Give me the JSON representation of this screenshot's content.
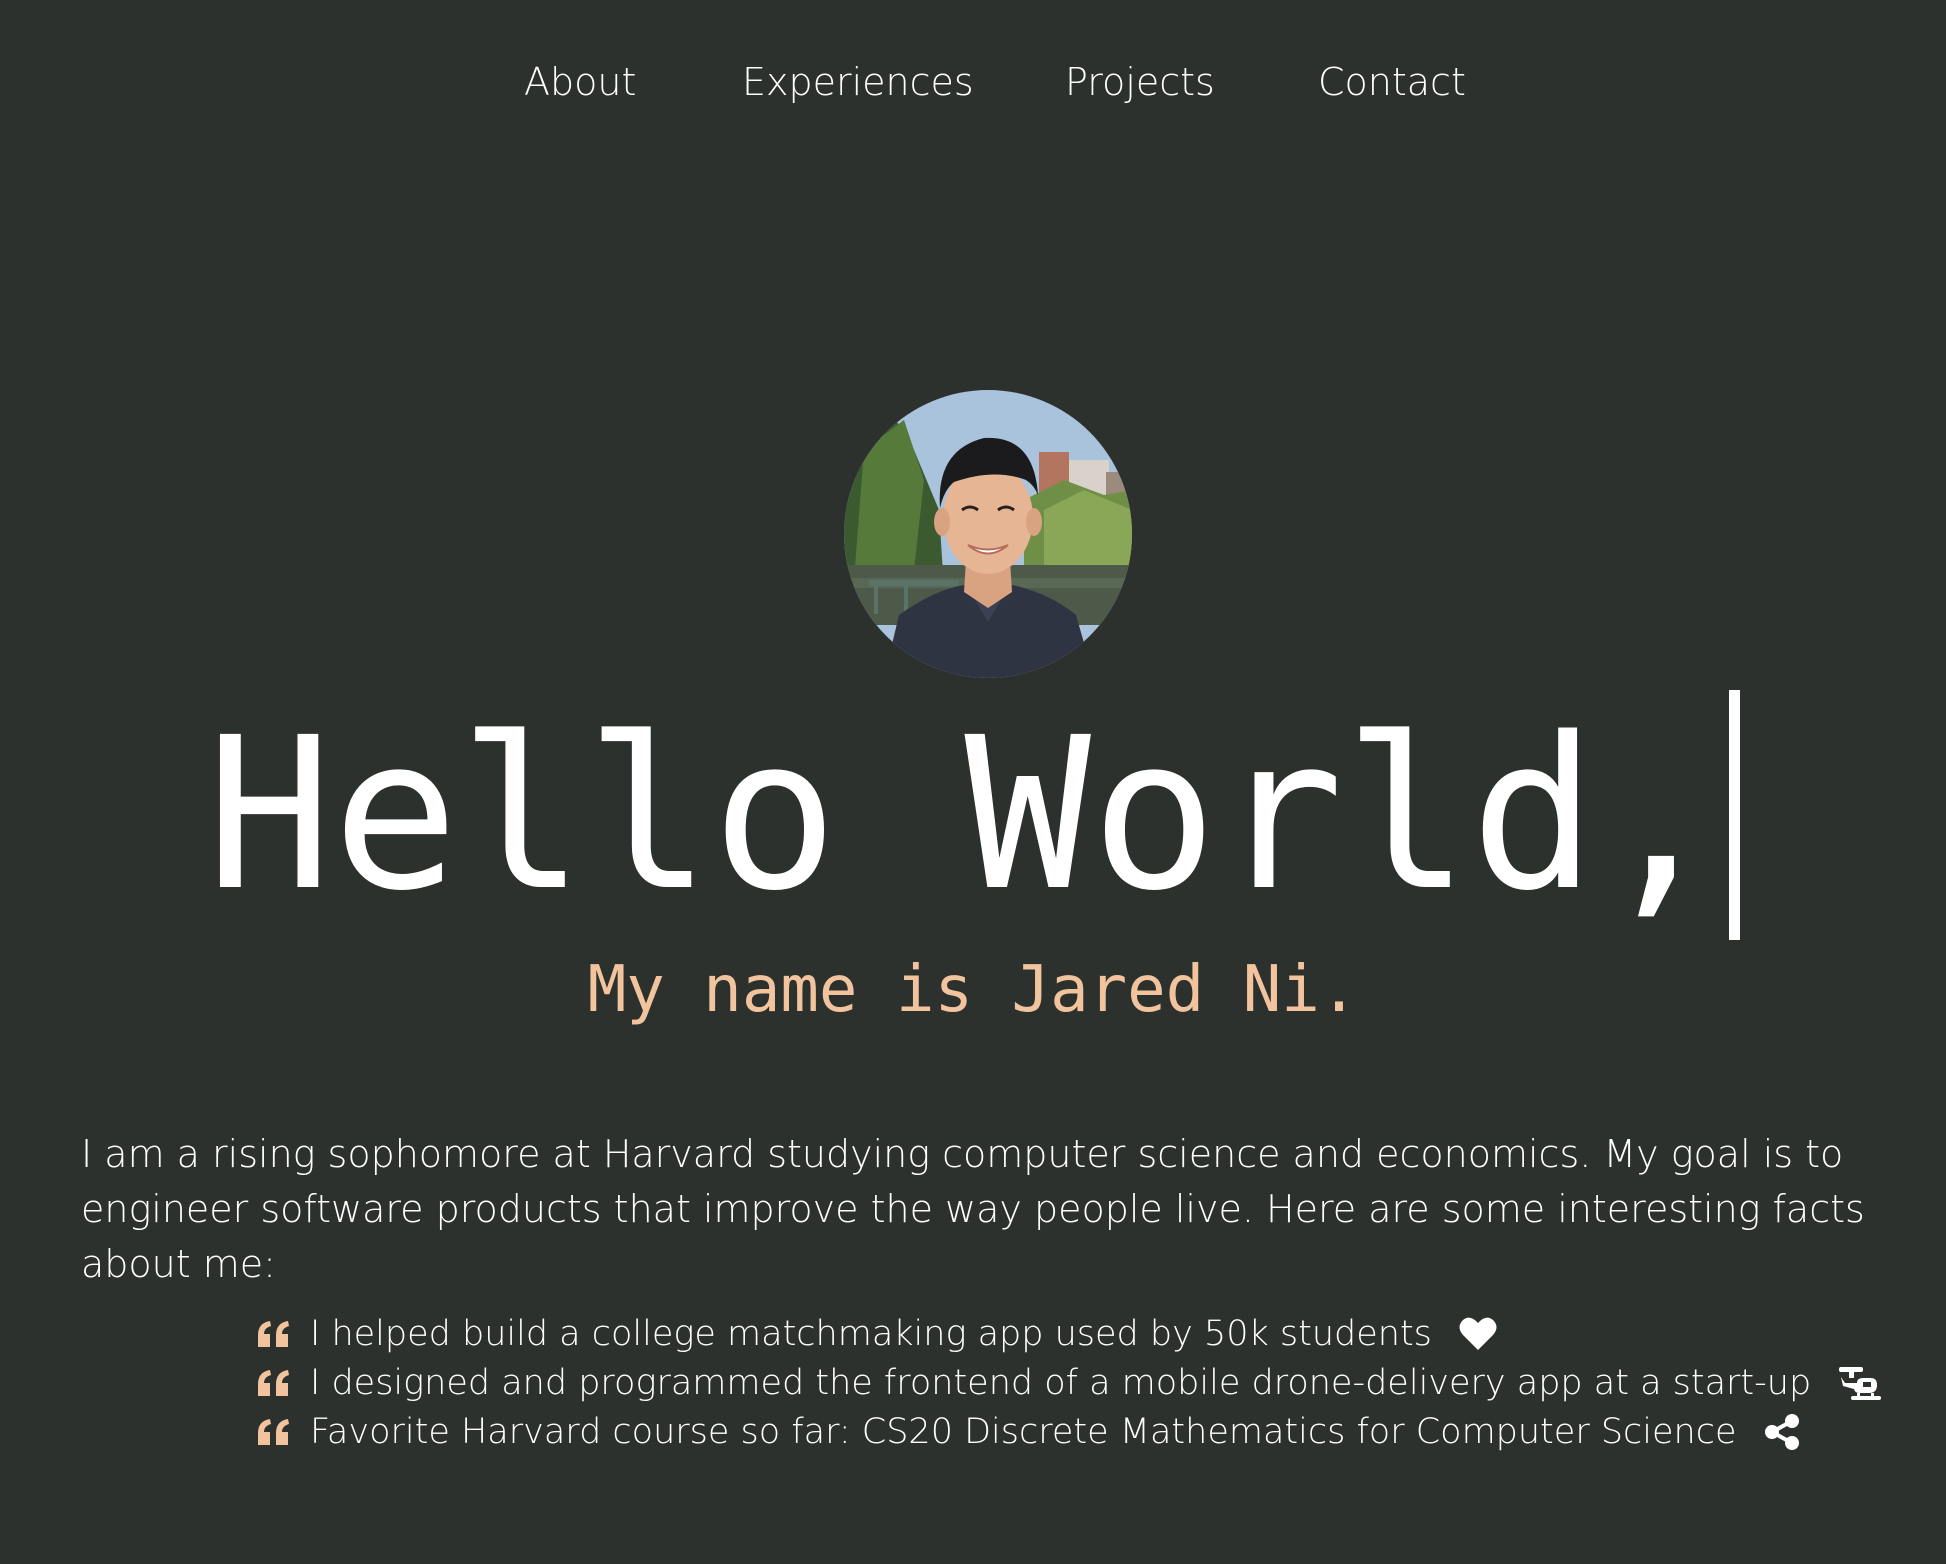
{
  "nav": {
    "items": [
      {
        "label": "About"
      },
      {
        "label": "Experiences"
      },
      {
        "label": "Projects"
      },
      {
        "label": "Contact"
      }
    ]
  },
  "hero": {
    "title": "Hello World,",
    "subtitle": "My name is Jared Ni."
  },
  "bio": {
    "text": "I am a rising sophomore at Harvard studying computer science and economics. My goal is to engineer software products that improve the way people live. Here are some interesting facts about me:"
  },
  "facts": [
    {
      "text": "I helped build a college matchmaking app used by 50k students",
      "icon": "heart-icon"
    },
    {
      "text": "I designed and programmed the frontend of a mobile drone-delivery app at a start-up",
      "icon": "helicopter-icon"
    },
    {
      "text": "Favorite Harvard course so far: CS20 Discrete Mathematics for Computer Science",
      "icon": "share-nodes-icon"
    }
  ],
  "colors": {
    "background": "#2d312e",
    "text": "#ffffff",
    "accent": "#f2c49e"
  }
}
